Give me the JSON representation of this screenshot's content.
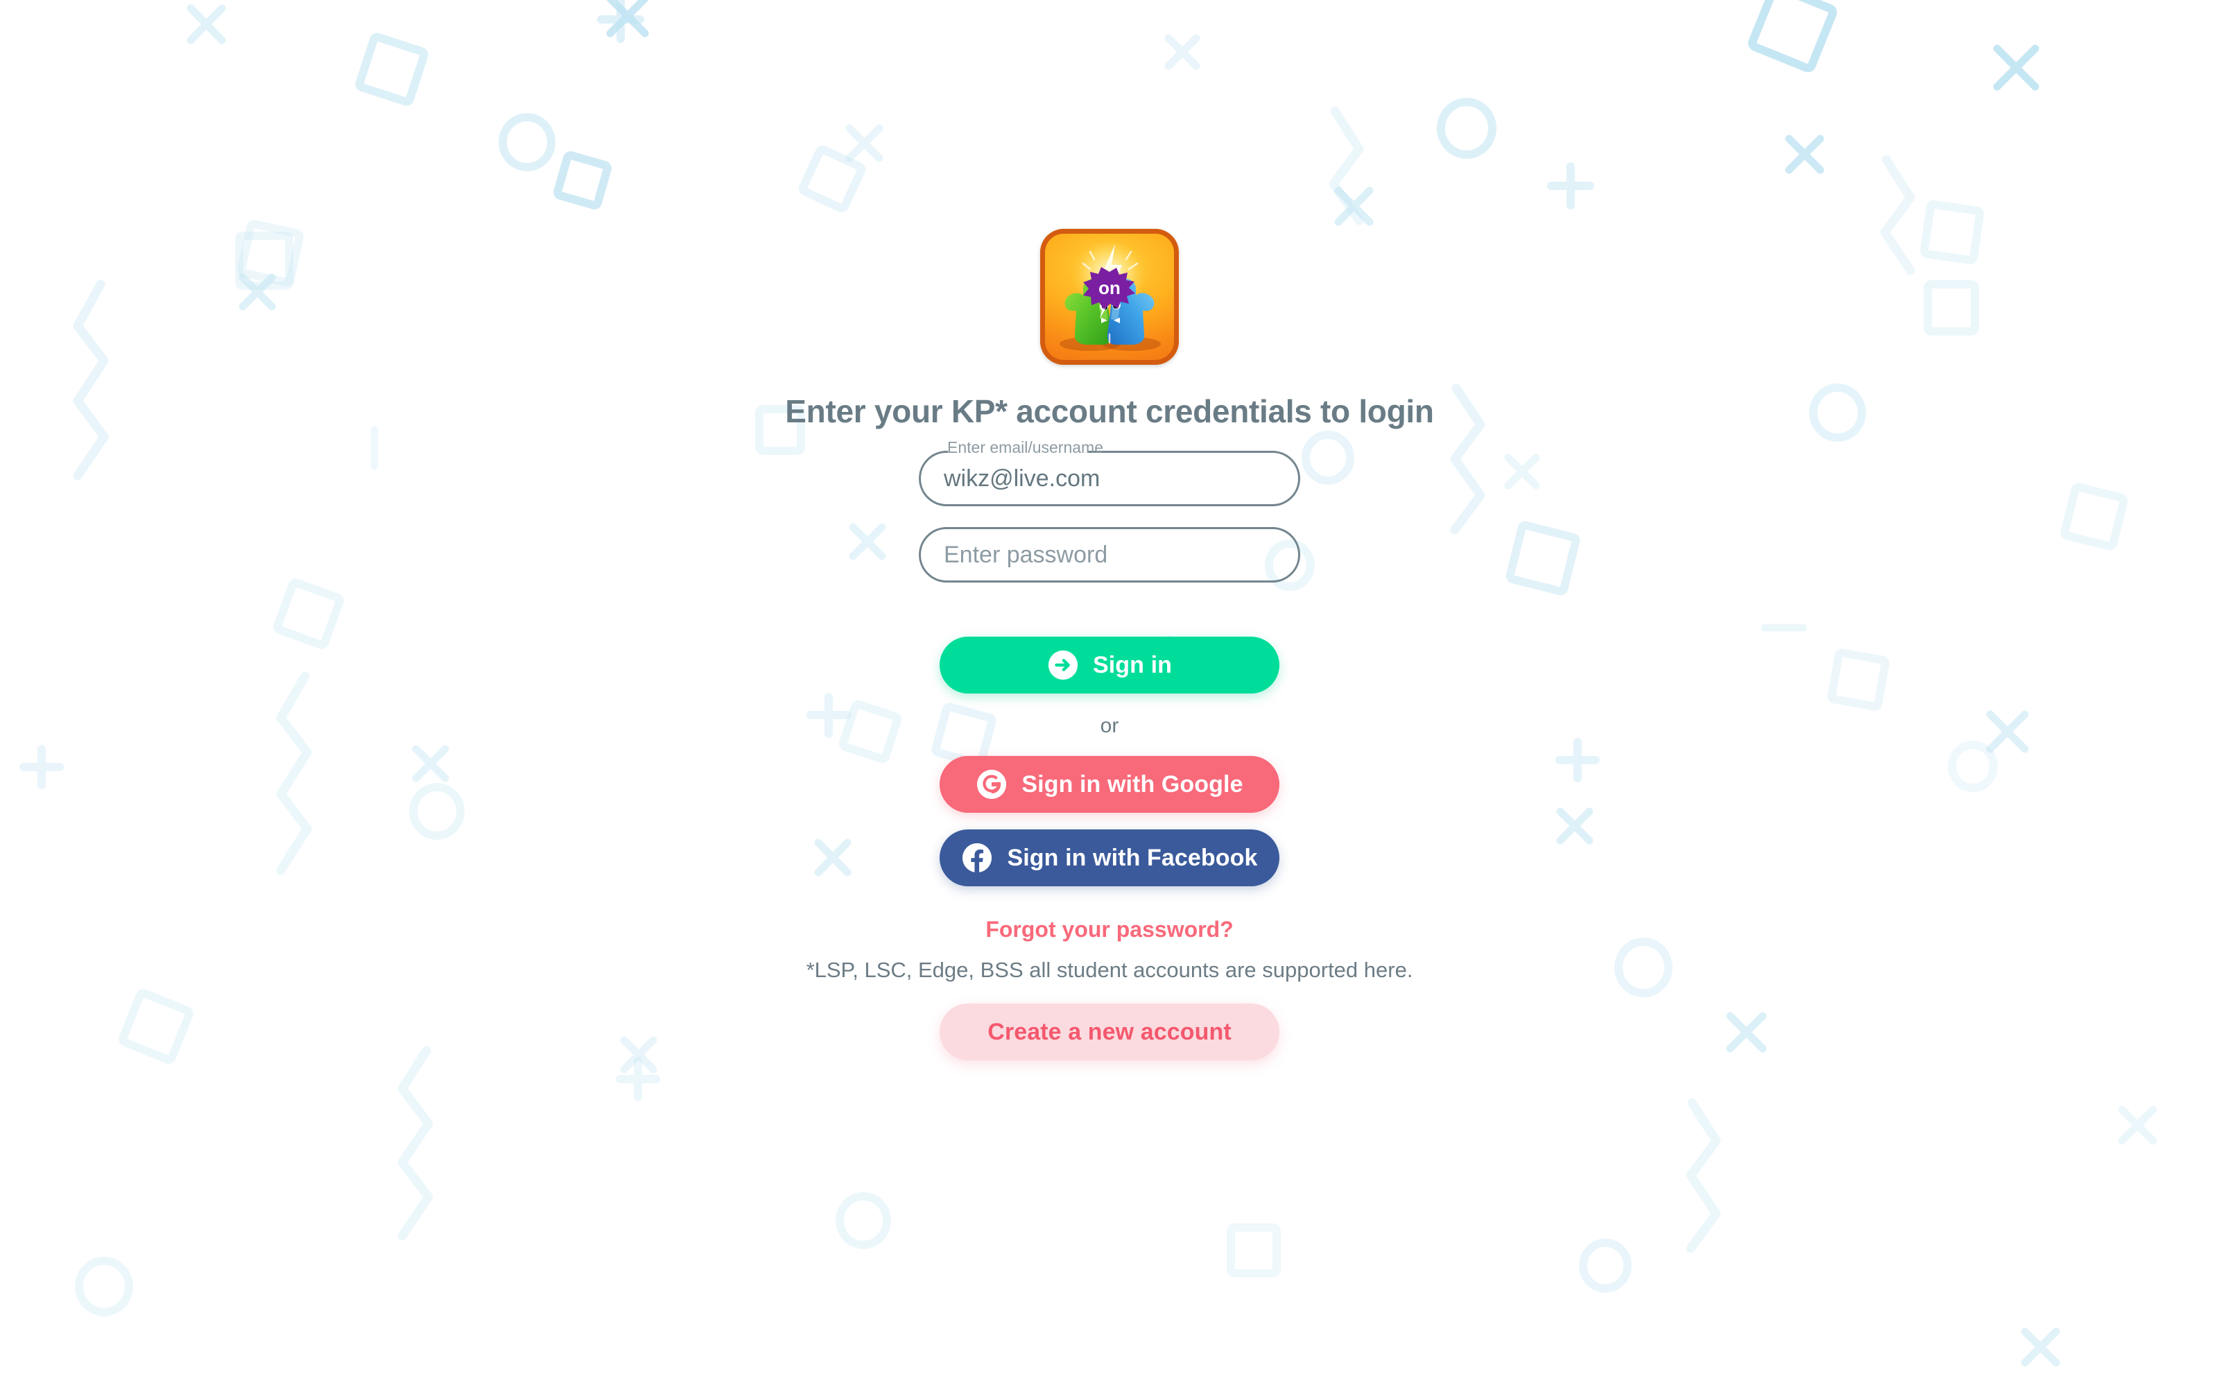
{
  "brand": {
    "logo_name": "one-on-one-app-logo",
    "logo_badge_text": "on",
    "colors": {
      "logo_bg_start": "#ffd23a",
      "logo_bg_end": "#f06a12",
      "logo_border": "#d35c10",
      "character_left": "#4cc62b",
      "character_right": "#3f9fe0",
      "badge": "#7b1fa2",
      "bolt": "#ffffff"
    }
  },
  "page": {
    "title": "Enter your KP* account credentials to login",
    "background_color": "#ffffff",
    "pattern_color": "#bfe3f2"
  },
  "form": {
    "email": {
      "label": "Enter email/username",
      "value": "wikz@live.com",
      "placeholder": ""
    },
    "password": {
      "label": "",
      "value": "",
      "placeholder": "Enter password"
    }
  },
  "actions": {
    "signin": {
      "label": "Sign in",
      "icon": "login-arrow-icon",
      "color": "#00dd9b"
    },
    "or": "or",
    "google": {
      "label": "Sign in with Google",
      "icon": "google-icon",
      "color": "#f8697a"
    },
    "facebook": {
      "label": "Sign in with Facebook",
      "icon": "facebook-icon",
      "color": "#3a5a9b"
    },
    "forgot_password": {
      "label": "Forgot your password?",
      "color": "#f8697a"
    },
    "create_account": {
      "label": "Create a new account",
      "color": "#f4586d",
      "background": "#fbdbe0"
    }
  },
  "notes": {
    "supported_accounts": "*LSP, LSC, Edge, BSS all student accounts are supported here."
  }
}
